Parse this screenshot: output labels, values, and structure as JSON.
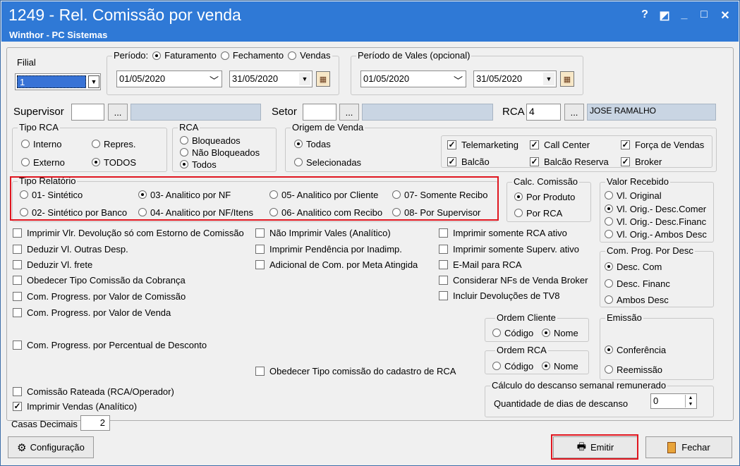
{
  "window": {
    "title": "1249 - Rel. Comissão por venda",
    "subtitle": "Winthor - PC Sistemas",
    "buttons": {
      "help": "?",
      "dock": "◩",
      "minimize": "_",
      "maximize": "□",
      "close": "✕"
    }
  },
  "filial": {
    "label": "Filial",
    "value": "1"
  },
  "periodo": {
    "label": "Período:",
    "options": [
      "Faturamento",
      "Fechamento",
      "Vendas"
    ],
    "date_from": "01/05/2020",
    "date_to": "31/05/2020"
  },
  "periodo_vales": {
    "label": "Período de Vales (opcional)",
    "date_from": "01/05/2020",
    "date_to": "31/05/2020"
  },
  "supervisor": {
    "label": "Supervisor",
    "code": "",
    "btn": "...",
    "name": ""
  },
  "setor": {
    "label": "Setor",
    "code": "",
    "btn": "...",
    "name": ""
  },
  "rca": {
    "label": "RCA",
    "code": "4",
    "btn": "...",
    "name": "JOSE RAMALHO"
  },
  "tipo_rca": {
    "title": "Tipo RCA",
    "options": [
      "Interno",
      "Repres.",
      "Externo",
      "TODOS"
    ]
  },
  "rca_group": {
    "title": "RCA",
    "options": [
      "Bloqueados",
      "Não Bloqueados",
      "Todos"
    ]
  },
  "origem": {
    "title": "Origem de Venda",
    "options": [
      "Todas",
      "Selecionadas"
    ]
  },
  "origem_checks": [
    "Telemarketing",
    "Call Center",
    "Força de Vendas",
    "Balcão",
    "Balcão Reserva",
    "Broker"
  ],
  "tipo_relatorio": {
    "title": "Tipo Relatório",
    "options": [
      "01- Sintético",
      "03- Analitico por NF",
      "05- Analitico por Cliente",
      "07- Somente Recibo",
      "02- Sintético por Banco",
      "04- Analitico por NF/Itens",
      "06- Analitico com Recibo",
      "08- Por Supervisor"
    ]
  },
  "calc_comissao": {
    "title": "Calc. Comissão",
    "options": [
      "Por Produto",
      "Por RCA"
    ]
  },
  "valor_recebido": {
    "title": "Valor Recebido",
    "options": [
      "Vl. Original",
      "Vl. Orig.- Desc.Comer",
      "Vl. Orig.- Desc.Financ",
      "Vl. Orig.- Ambos Desc"
    ]
  },
  "com_prog_desc": {
    "title": "Com. Prog. Por Desc",
    "options": [
      "Desc. Com",
      "Desc. Financ",
      "Ambos Desc"
    ]
  },
  "emissao": {
    "title": "Emissão",
    "options": [
      "Conferência",
      "Reemissão"
    ]
  },
  "ordem_cliente": {
    "title": "Ordem Cliente",
    "options": [
      "Código",
      "Nome"
    ]
  },
  "ordem_rca": {
    "title": "Ordem RCA",
    "options": [
      "Código",
      "Nome"
    ]
  },
  "checks_col1": [
    "Imprimir Vlr. Devolução só com Estorno de Comissão",
    "Deduzir Vl. Outras Desp.",
    "Deduzir Vl. frete",
    "Obedecer Tipo Comissão da Cobrança",
    "Com. Progress. por Valor de Comissão",
    "Com. Progress. por Valor de Venda",
    "Com. Progress. por Percentual de Desconto",
    "Comissão Rateada (RCA/Operador)",
    "Imprimir Vendas (Analítico)"
  ],
  "checks_col2": [
    "Não Imprimir Vales (Analítico)",
    "Imprimir Pendência por Inadimp.",
    "Adicional de Com. por Meta Atingida",
    "Obedecer Tipo comissão do cadastro de RCA"
  ],
  "checks_col3": [
    "Imprimir somente RCA ativo",
    "Imprimir somente Superv. ativo",
    "E-Mail para RCA",
    "Considerar NFs de Venda Broker",
    "Incluir Devoluções de TV8"
  ],
  "dsr": {
    "title": "Cálculo do descanso semanal remunerado",
    "label": "Quantidade de dias de descanso",
    "value": "0"
  },
  "casas": {
    "label": "Casas Decimais",
    "value": "2"
  },
  "buttons": {
    "config": "Configuração",
    "emitir": "Emitir",
    "fechar": "Fechar"
  },
  "colors": {
    "titlebar": "#2f79d6",
    "highlight": "#e0161f",
    "readonly": "#c9d5e3"
  }
}
